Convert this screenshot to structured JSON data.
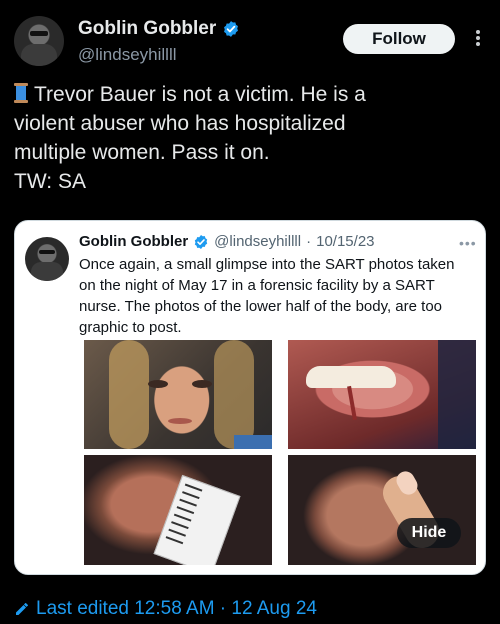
{
  "author": {
    "display_name": "Goblin Gobbler",
    "handle": "@lindseyhillll",
    "avatar_icon": "avatar-icon",
    "verified_icon": "verified-badge-icon"
  },
  "follow_label": "Follow",
  "more_icon": "more-vertical-icon",
  "tweet": {
    "lines": [
      "Trevor Bauer is not a victim. He is a",
      "violent abuser who has hospitalized",
      "multiple women. Pass it on.",
      "TW: SA"
    ],
    "emoji_icon": "thread-spool-icon"
  },
  "quote": {
    "display_name": "Goblin Gobbler",
    "handle": "@lindseyhillll",
    "separator": "·",
    "date": "10/15/23",
    "more_icon": "more-horizontal-icon",
    "lines": [
      "Once again, a small glimpse into the SART photos taken",
      "on the night of May 17 in a forensic facility by a SART",
      "nurse. The photos of the lower half of the body, are too",
      "graphic to post."
    ],
    "hide_label": "Hide"
  },
  "edited": {
    "icon": "pencil-icon",
    "text": "Last edited 12:58 AM · 12 Aug 24"
  },
  "colors": {
    "background": "#000000",
    "link": "#1d9bf0",
    "verified": "#1d9bf0"
  }
}
